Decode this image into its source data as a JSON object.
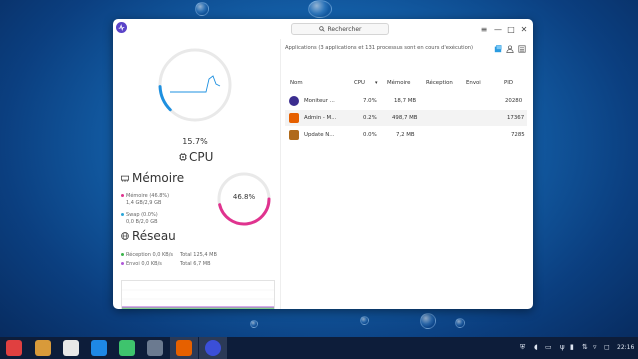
{
  "window": {
    "search_placeholder": "Rechercher",
    "controls": [
      "≡",
      "—",
      "□",
      "✕"
    ]
  },
  "cpu": {
    "percent_text": "15.7%",
    "percent": 15.7,
    "label": "CPU",
    "ring_color": "#1e90e0"
  },
  "memory": {
    "title": "Mémoire",
    "mem_label": "Mémoire (46.8%)",
    "mem_detail": "1,4 GB/2,9 GB",
    "swap_label": "Swap (0.0%)",
    "swap_detail": "0,0 B/2,0 GB",
    "percent_text": "46.8%",
    "percent": 46.8,
    "mem_color": "#e0338f",
    "swap_color": "#2aa6d8"
  },
  "network": {
    "title": "Réseau",
    "recv_label": "Réception 0,0 KB/s",
    "recv_total": "Total 125,4 MB",
    "send_label": "Envoi 0,0 KB/s",
    "send_total": "Total 6,7 MB",
    "recv_color": "#3cb44b",
    "send_color": "#b05ad8"
  },
  "apps": {
    "summary": "Applications (3 applications et 131 processus sont en cours d'exécution)",
    "columns": {
      "name": "Nom",
      "cpu": "CPU",
      "memory": "Mémoire",
      "recv": "Réception",
      "send": "Envoi",
      "pid": "PID"
    },
    "rows": [
      {
        "name": "Moniteur ...",
        "cpu": "7.0%",
        "memory": "18,7 MB",
        "recv": "",
        "send": "",
        "pid": "20280",
        "icon": "system-monitor-icon",
        "icon_color": "#3b2d8f"
      },
      {
        "name": "Admin - M...",
        "cpu": "0.2%",
        "memory": "498,7 MB",
        "recv": "",
        "send": "",
        "pid": "17367",
        "icon": "firefox-icon",
        "icon_color": "#e66000"
      },
      {
        "name": "Update N...",
        "cpu": "0.0%",
        "memory": "7,2 MB",
        "recv": "",
        "send": "",
        "pid": "7285",
        "icon": "package-icon",
        "icon_color": "#b06a1a"
      }
    ]
  },
  "taskbar": {
    "clock": "22:16",
    "apps": [
      {
        "name": "launcher-icon",
        "color": "#e04040"
      },
      {
        "name": "files-icon",
        "color": "#d89a3a"
      },
      {
        "name": "text-editor-icon",
        "color": "#e8e8e8"
      },
      {
        "name": "store-icon",
        "color": "#1e88e5"
      },
      {
        "name": "terminal-icon",
        "color": "#3ec46d"
      },
      {
        "name": "settings-icon",
        "color": "#6b7a90"
      },
      {
        "name": "firefox-icon",
        "color": "#e66000"
      },
      {
        "name": "system-monitor-icon",
        "color": "#3b4fd8"
      }
    ]
  }
}
